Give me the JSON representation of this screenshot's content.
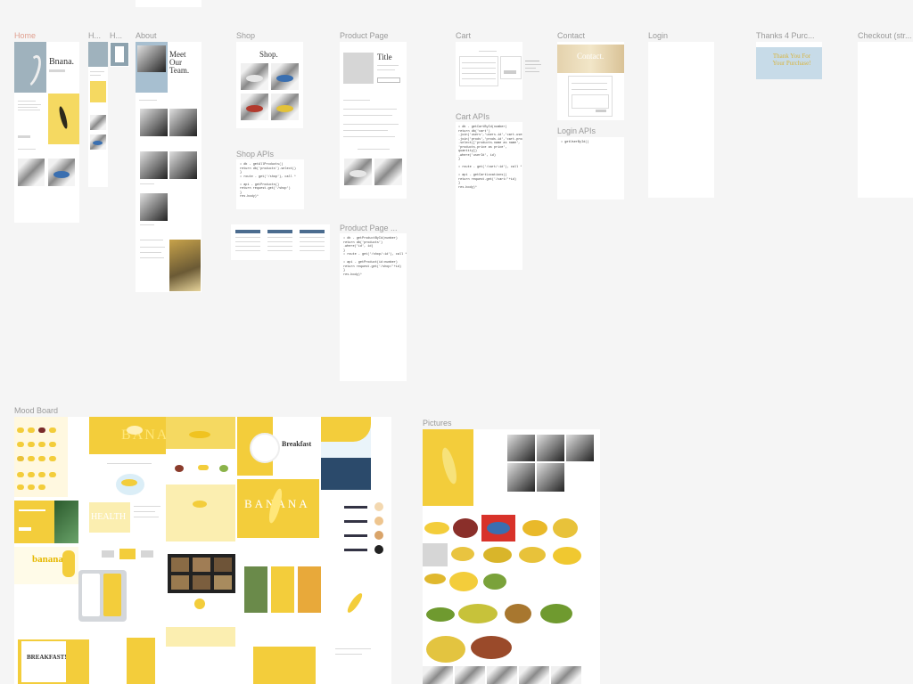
{
  "frames": {
    "home": {
      "label": "Home",
      "title": "Bnana."
    },
    "h1": {
      "label": "H..."
    },
    "h2": {
      "label": "H..."
    },
    "about": {
      "label": "About",
      "title": "Meet Our Team."
    },
    "shop": {
      "label": "Shop",
      "title": "Shop."
    },
    "product_page": {
      "label": "Product Page",
      "title": "Title"
    },
    "cart": {
      "label": "Cart"
    },
    "contact": {
      "label": "Contact",
      "title": "Contact."
    },
    "login": {
      "label": "Login"
    },
    "thanks": {
      "label": "Thanks 4 Purc...",
      "title_line1": "Thank You For",
      "title_line2": "Your Purchase!"
    },
    "checkout": {
      "label": "Checkout (str..."
    },
    "shop_apis": {
      "label": "Shop APIs"
    },
    "cart_apis": {
      "label": "Cart APIs"
    },
    "login_apis": {
      "label": "Login APIs"
    },
    "product_page_apis": {
      "label": "Product Page ..."
    },
    "mood_board": {
      "label": "Mood Board"
    },
    "pictures": {
      "label": "Pictures"
    }
  },
  "code": {
    "shop_apis": "• db - getAllProducts()\nreturn db('products').select()\n}\n• route - get('/shop'), call *\n\n• api - getProducts()\nreturn request.get('/shop')\n}\nres.body)*",
    "cart_apis": "• db - getCartById(number)\nreturn db('cart')\n.join('users','users.id','cart.userId')\n.join('prods','prods.id','cart.prodId')\n.select(['products.name as name',\n'products.price as price',\nquantity])\n.where('userId', id)\n}\n\n• route - get('/cart/:id'), call *\n\n• api - getCartLocations()\nreturn request.get('/cart/'+id)\n}\nres.body)*",
    "login_apis": "• getUserById()",
    "product_page_apis": "• db - getProductById(number)\nreturn db('products')\n.where('id', id)\n}\n• route - get('/shop/:id'), call *\n\n• api - getProduct(id:number)\nreturn request.get('/shop/'+id)\n}\nres.body)*"
  },
  "mood_board": {
    "headline_breakfast": "Breakfast",
    "headline_banana": "BANANA",
    "headline_banana_ghost": "BANANA",
    "headline_banana_small": "banana",
    "headline_healthy": "HEALTH",
    "headline_breakfast2": "BREAKFAST!"
  },
  "colors": {
    "canvas": "#f5f5f5",
    "banana_yellow": "#f3cd3b",
    "label_gray": "#9a9a9a",
    "red_banana": "#b23a2e",
    "blue_banana": "#3a6fb0"
  }
}
